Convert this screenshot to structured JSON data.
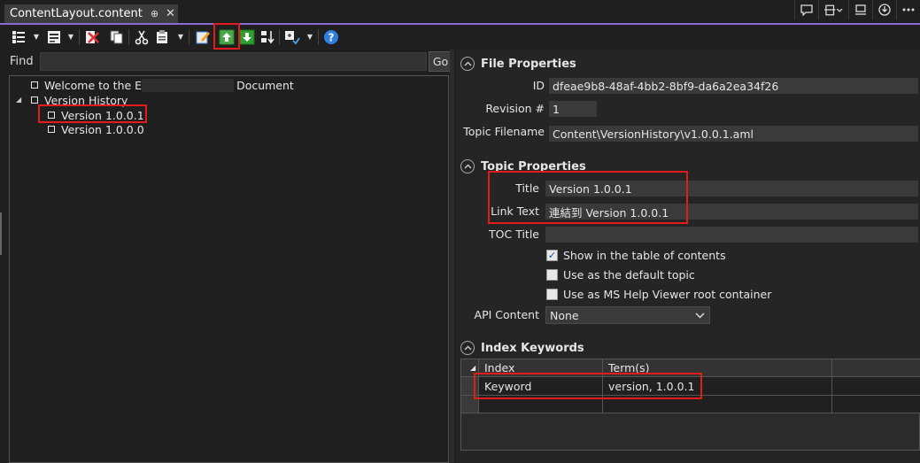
{
  "tab": {
    "title": "ContentLayout.content",
    "pin_glyph": "⊕",
    "close_glyph": "✕"
  },
  "window_buttons": [
    {
      "name": "feedback-icon",
      "glyph": "☐"
    },
    {
      "name": "layout-icon",
      "glyph": "⎙ ⌄"
    },
    {
      "name": "dock-icon",
      "glyph": "⎗"
    },
    {
      "name": "download-icon",
      "glyph": "⤓"
    },
    {
      "name": "more-icon",
      "glyph": "…"
    }
  ],
  "toolbar": {
    "items": [
      "add-topic",
      "add-sibling",
      "delete-topic",
      "copy-topic",
      "cut-topic",
      "paste-topic",
      "edit-topic",
      "move-up",
      "move-down",
      "sort-topics",
      "expand-collapse",
      "help"
    ]
  },
  "find": {
    "label": "Find",
    "value": "",
    "go_label": "Go"
  },
  "tree": {
    "items": [
      {
        "label_start": "Welcome to the E",
        "label_end": "Document",
        "level": 0
      },
      {
        "label": "Version History",
        "level": 0,
        "expanded": true
      },
      {
        "label": "Version 1.0.0.1",
        "level": 1,
        "selected": true
      },
      {
        "label": "Version 1.0.0.0",
        "level": 1
      }
    ]
  },
  "file_properties": {
    "title": "File Properties",
    "id_label": "ID",
    "id_value": "dfeae9b8-48af-4bb2-8bf9-da6a2ea34f26",
    "revision_label": "Revision #",
    "revision_value": "1",
    "filename_label": "Topic Filename",
    "filename_value": "Content\\VersionHistory\\v1.0.0.1.aml"
  },
  "topic_properties": {
    "title": "Topic Properties",
    "title_label": "Title",
    "title_value": "Version 1.0.0.1",
    "link_label": "Link Text",
    "link_value": "連結到 Version 1.0.0.1",
    "toc_label": "TOC Title",
    "toc_value": "",
    "checkboxes": [
      {
        "label": "Show in the table of contents",
        "checked": true
      },
      {
        "label": "Use as the default topic",
        "checked": false
      },
      {
        "label": "Use as MS Help Viewer root container",
        "checked": false
      }
    ],
    "api_label": "API Content",
    "api_value": "None"
  },
  "index_keywords": {
    "title": "Index Keywords",
    "columns": [
      "Index",
      "Term(s)"
    ],
    "rows": [
      {
        "index": "Keyword",
        "terms": "version, 1.0.0.1"
      }
    ]
  },
  "colors": {
    "accent": "#8a6ad8",
    "highlight": "#e21b1b",
    "background": "#1f1f1f"
  }
}
